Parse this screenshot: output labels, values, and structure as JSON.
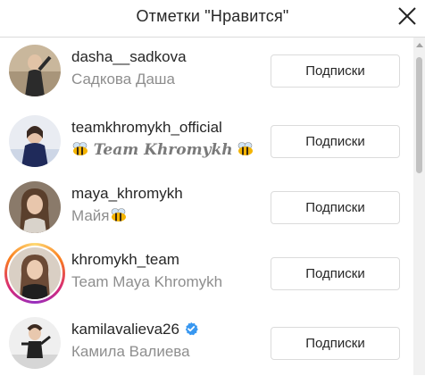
{
  "header": {
    "title": "Отметки \"Нравится\""
  },
  "colors": {
    "verified": "#3897f0",
    "button_border": "#dbdbdb",
    "secondary_text": "#8e8e8e"
  },
  "follow_label": "Подписки",
  "users": [
    {
      "username": "dasha__sadkova",
      "fullname": "Садкова Даша"
    },
    {
      "username": "teamkhromykh_official",
      "fullname": "Team Khromykh",
      "fullname_style": "bee-flanked"
    },
    {
      "username": "maya_khromykh",
      "fullname": "Майя",
      "fullname_suffix_icon": "bee-icon"
    },
    {
      "username": "khromykh_team",
      "fullname": "Team Maya Khromykh",
      "has_story": true
    },
    {
      "username": "kamilavalieva26",
      "fullname": "Камила Валиева",
      "verified": true
    }
  ]
}
